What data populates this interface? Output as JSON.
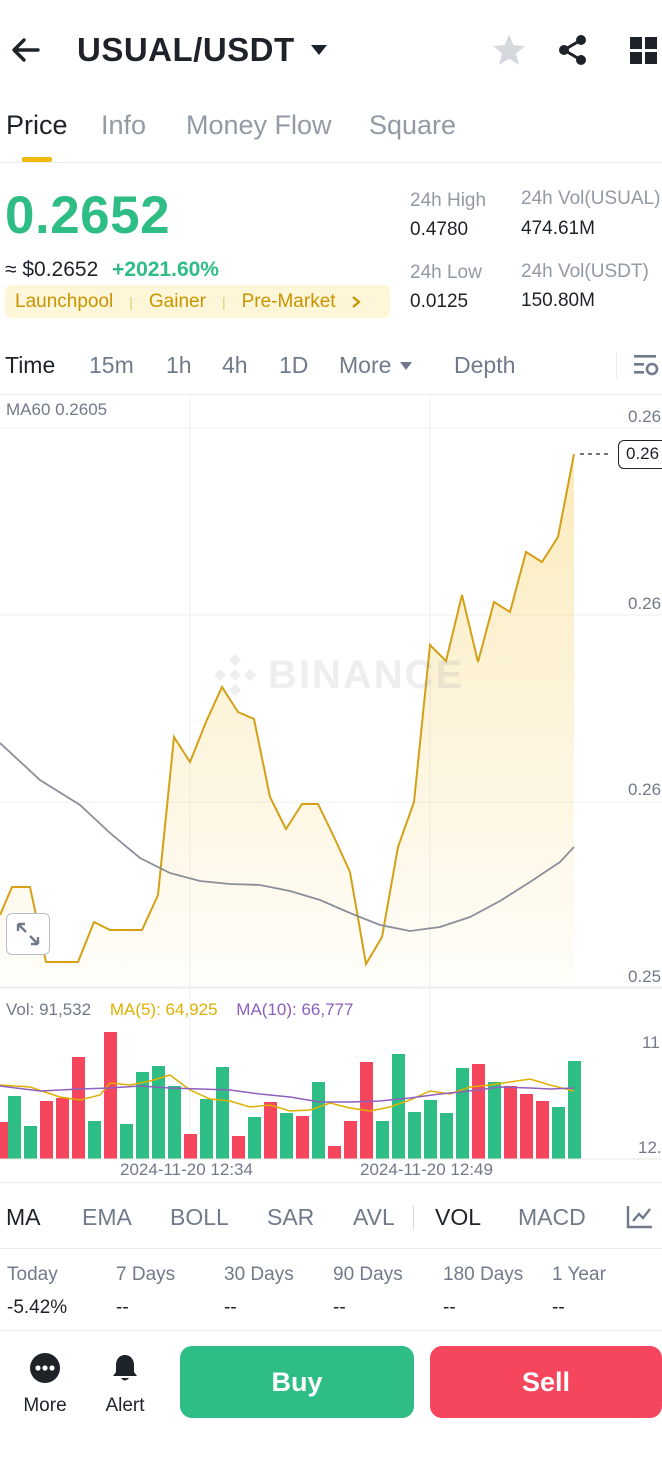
{
  "header": {
    "title": "USUAL/USDT"
  },
  "tabs": [
    {
      "label": "Price",
      "active": true
    },
    {
      "label": "Info"
    },
    {
      "label": "Money Flow"
    },
    {
      "label": "Square"
    }
  ],
  "ticker": {
    "last_price": "0.2652",
    "approx_usd": "≈ $0.2652",
    "change_pct": "+2021.60%",
    "tags": [
      "Launchpool",
      "Gainer",
      "Pre-Market"
    ],
    "high_label": "24h High",
    "high_value": "0.4780",
    "low_label": "24h Low",
    "low_value": "0.0125",
    "vol_base_label": "24h Vol(USUAL)",
    "vol_base_value": "474.61M",
    "vol_quote_label": "24h Vol(USDT)",
    "vol_quote_value": "150.80M"
  },
  "timeframes": {
    "items": [
      "Time",
      "15m",
      "1h",
      "4h",
      "1D"
    ],
    "active": "Time",
    "more_label": "More",
    "depth_label": "Depth"
  },
  "chart": {
    "ma60_label": "MA60 0.2605",
    "watermark": "BINANCE",
    "price_ticks": [
      "0.26",
      "0.26",
      "0.26",
      "0.25"
    ],
    "current_tag": "0.26",
    "vol_label": "Vol: 91,532",
    "ma5_label": "MA(5): 64,925",
    "ma10_label": "MA(10): 66,777",
    "vol_ticks": [
      "11",
      "12."
    ],
    "x_labels": [
      "2024-11-20 12:34",
      "2024-11-20 12:49"
    ],
    "colors": {
      "line": "#d4a017",
      "ma60": "#8a8f99",
      "up": "#2ebd85",
      "down": "#f6465d",
      "ma5": "#e0b000",
      "ma10": "#8e5fbf"
    }
  },
  "indicators": {
    "items": [
      "MA",
      "EMA",
      "BOLL",
      "SAR",
      "AVL",
      "VOL",
      "MACD"
    ],
    "active": [
      "MA",
      "VOL"
    ]
  },
  "performance": [
    {
      "label": "Today",
      "value": "-5.42%"
    },
    {
      "label": "7 Days",
      "value": "--"
    },
    {
      "label": "30 Days",
      "value": "--"
    },
    {
      "label": "90 Days",
      "value": "--"
    },
    {
      "label": "180 Days",
      "value": "--"
    },
    {
      "label": "1 Year",
      "value": "--"
    }
  ],
  "bottom": {
    "more_label": "More",
    "alert_label": "Alert",
    "buy_label": "Buy",
    "sell_label": "Sell"
  }
}
